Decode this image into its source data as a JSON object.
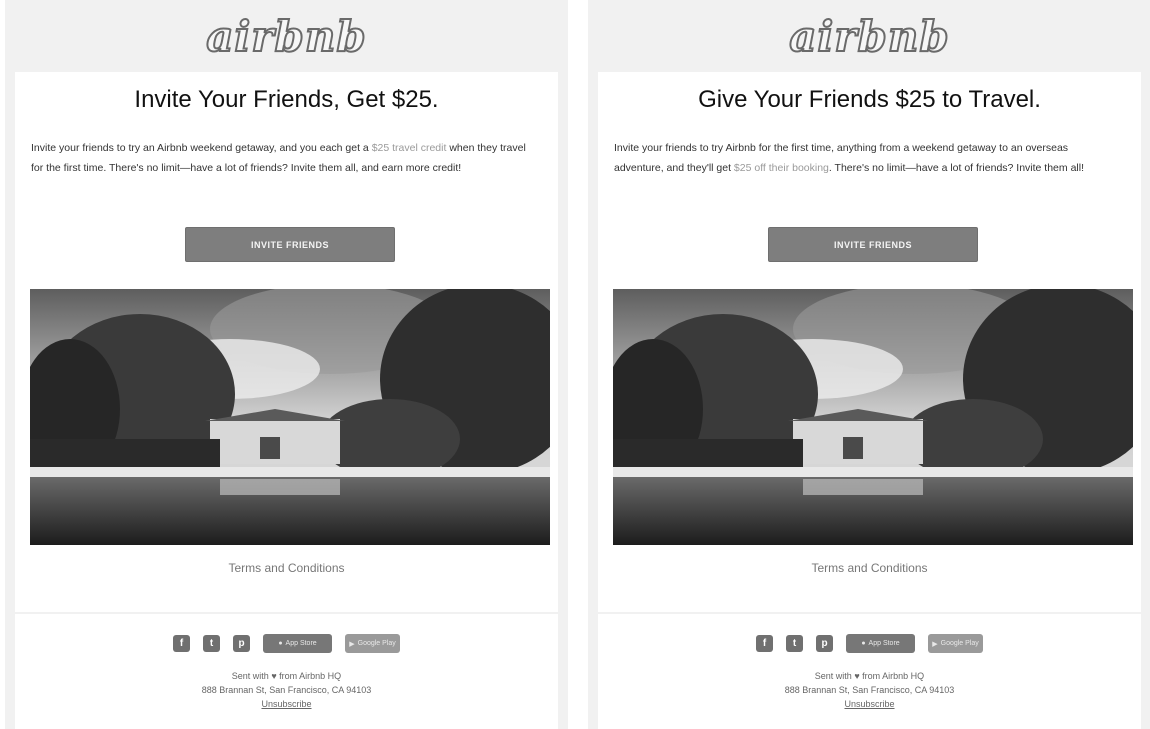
{
  "logo": "airbnb",
  "panels": [
    {
      "headline": "Invite Your Friends, Get $25.",
      "body_before_link": "Invite your friends to try an Airbnb weekend getaway, and you each get a ",
      "body_link": "$25 travel credit",
      "body_after_link": " when they travel for the first time. There's no limit—have a lot of friends? Invite them all, and earn more credit!",
      "cta_label": "INVITE FRIENDS",
      "terms_label": "Terms and Conditions"
    },
    {
      "headline": "Give Your Friends $25 to Travel.",
      "body_before_link": "Invite your friends to try Airbnb for the first time, anything from a weekend getaway to an overseas adventure, and they'll get ",
      "body_link": "$25 off their booking",
      "body_after_link": ". There's no limit—have a lot of friends? Invite them all!",
      "cta_label": "INVITE FRIENDS",
      "terms_label": "Terms and Conditions"
    }
  ],
  "footer": {
    "social_icons": [
      {
        "name": "facebook-icon",
        "glyph": "f"
      },
      {
        "name": "twitter-icon",
        "glyph": "t"
      },
      {
        "name": "pinterest-icon",
        "glyph": "p"
      }
    ],
    "app_store_label": "App Store",
    "google_play_label": "Google Play",
    "sent_line": "Sent with ♥ from Airbnb HQ",
    "address": "888 Brannan St, San Francisco, CA 94103",
    "unsubscribe": "Unsubscribe"
  },
  "colors": {
    "background": "#f1f1f1",
    "card": "#ffffff",
    "button": "#7e7e7e",
    "link": "#9a9a9a"
  }
}
